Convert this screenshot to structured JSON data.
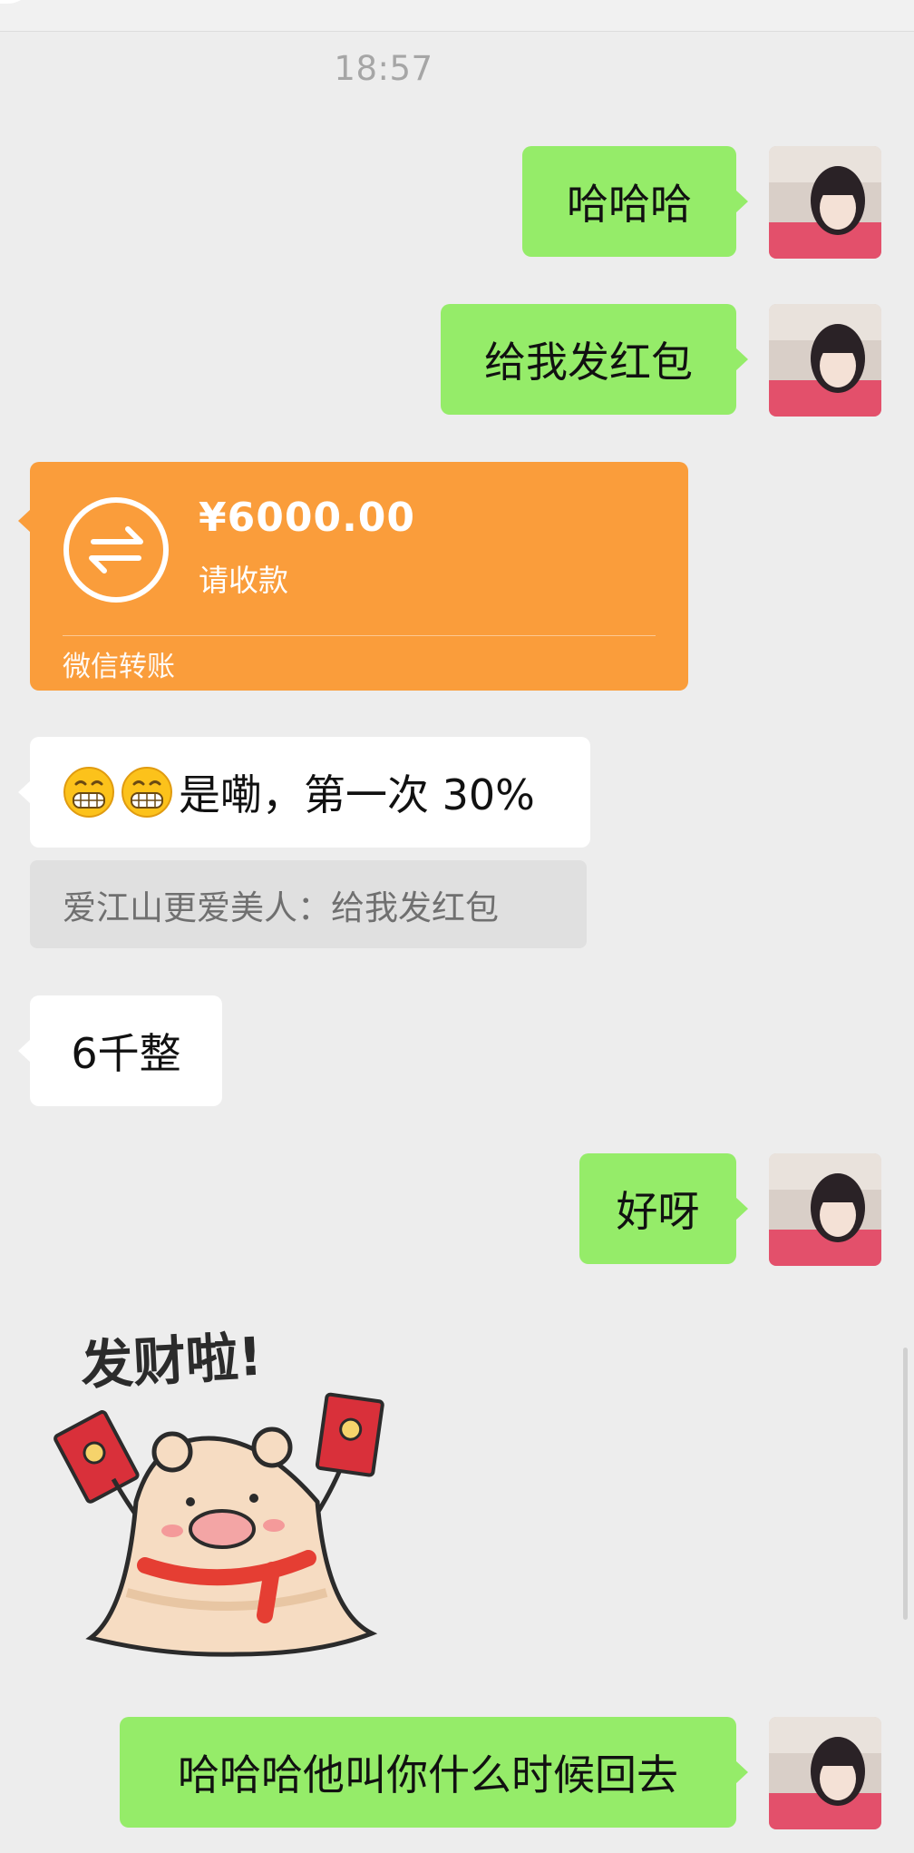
{
  "chat": {
    "timestamp": "18:57",
    "messages": {
      "m1": "哈哈哈",
      "m2": "给我发红包",
      "m4": "是嘞，第一次 30%",
      "m5": "6千整",
      "m6": "好呀",
      "m8": "哈哈哈他叫你什么时候回去"
    },
    "transfer": {
      "amount": "¥6000.00",
      "status": "请收款",
      "footer": "微信转账",
      "color": "#fa9d3b"
    },
    "quote": "爱江山更爱美人：给我发红包",
    "sticker_text": "发财啦!"
  },
  "colors": {
    "sent_bubble": "#95ec69",
    "received_bubble": "#ffffff",
    "background": "#ededed"
  },
  "icons": {
    "transfer": "transfer-arrows-icon",
    "emoji": "grinning-face-icon"
  }
}
